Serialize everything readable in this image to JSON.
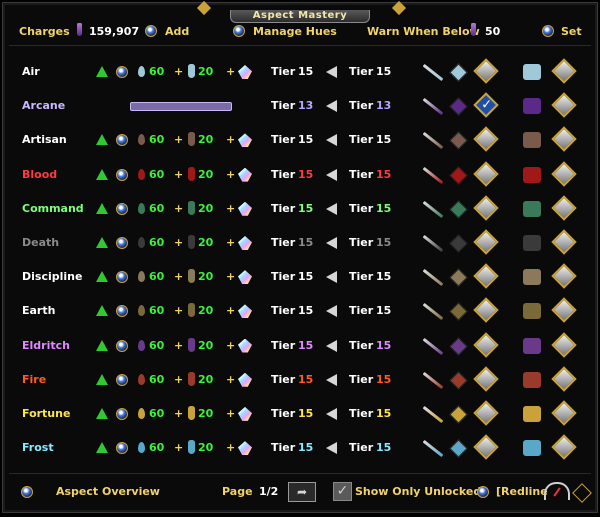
{
  "window": {
    "title": "Aspect Mastery"
  },
  "header": {
    "charges_label": "Charges",
    "charges_value": "159,907",
    "add_label": "Add",
    "manage_hues_label": "Manage Hues",
    "warn_label": "Warn When Below",
    "warn_value": "50",
    "set_label": "Set"
  },
  "aspects": [
    {
      "name": "Air",
      "color": "#ffffff",
      "unlocked": true,
      "stat1": "60",
      "stat2": "20",
      "tier_label": "Tier",
      "tier_a": "15",
      "tier_b": "15",
      "tier_color": "#ffffff",
      "accent": "#9fc8d8",
      "checked": false
    },
    {
      "name": "Arcane",
      "color": "#c9b8ff",
      "unlocked": false,
      "stat1": "",
      "stat2": "",
      "tier_label": "Tier",
      "tier_a": "13",
      "tier_b": "13",
      "tier_color": "#b2a8ff",
      "accent": "#5a2a8a",
      "checked": true
    },
    {
      "name": "Artisan",
      "color": "#ffffff",
      "unlocked": true,
      "stat1": "60",
      "stat2": "20",
      "tier_label": "Tier",
      "tier_a": "15",
      "tier_b": "15",
      "tier_color": "#ffffff",
      "accent": "#7a5a4a",
      "checked": false
    },
    {
      "name": "Blood",
      "color": "#ff3b3b",
      "unlocked": true,
      "stat1": "60",
      "stat2": "20",
      "tier_label": "Tier",
      "tier_a": "15",
      "tier_b": "15",
      "tier_color": "#ff3b3b",
      "accent": "#a01818",
      "checked": false
    },
    {
      "name": "Command",
      "color": "#7dff7d",
      "unlocked": true,
      "stat1": "60",
      "stat2": "20",
      "tier_label": "Tier",
      "tier_a": "15",
      "tier_b": "15",
      "tier_color": "#7dff7d",
      "accent": "#3a7a5a",
      "checked": false
    },
    {
      "name": "Death",
      "color": "#8a8a8a",
      "unlocked": true,
      "stat1": "60",
      "stat2": "20",
      "tier_label": "Tier",
      "tier_a": "15",
      "tier_b": "15",
      "tier_color": "#8a8a8a",
      "accent": "#3a3a3a",
      "checked": false
    },
    {
      "name": "Discipline",
      "color": "#ffffff",
      "unlocked": true,
      "stat1": "60",
      "stat2": "20",
      "tier_label": "Tier",
      "tier_a": "15",
      "tier_b": "15",
      "tier_color": "#ffffff",
      "accent": "#8a7a5a",
      "checked": false
    },
    {
      "name": "Earth",
      "color": "#ffffff",
      "unlocked": true,
      "stat1": "60",
      "stat2": "20",
      "tier_label": "Tier",
      "tier_a": "15",
      "tier_b": "15",
      "tier_color": "#ffffff",
      "accent": "#7a6a3a",
      "checked": false
    },
    {
      "name": "Eldritch",
      "color": "#e08aff",
      "unlocked": true,
      "stat1": "60",
      "stat2": "20",
      "tier_label": "Tier",
      "tier_a": "15",
      "tier_b": "15",
      "tier_color": "#e08aff",
      "accent": "#6a3a8a",
      "checked": false
    },
    {
      "name": "Fire",
      "color": "#ff5a2a",
      "unlocked": true,
      "stat1": "60",
      "stat2": "20",
      "tier_label": "Tier",
      "tier_a": "15",
      "tier_b": "15",
      "tier_color": "#ff5a2a",
      "accent": "#9a3a2a",
      "checked": false
    },
    {
      "name": "Fortune",
      "color": "#ffe34a",
      "unlocked": true,
      "stat1": "60",
      "stat2": "20",
      "tier_label": "Tier",
      "tier_a": "15",
      "tier_b": "15",
      "tier_color": "#ffe34a",
      "accent": "#c9a23a",
      "checked": false
    },
    {
      "name": "Frost",
      "color": "#8ae8ff",
      "unlocked": true,
      "stat1": "60",
      "stat2": "20",
      "tier_label": "Tier",
      "tier_a": "15",
      "tier_b": "15",
      "tier_color": "#8ae8ff",
      "accent": "#5aa8c8",
      "checked": false
    }
  ],
  "footer": {
    "overview_label": "Aspect Overview",
    "page_label": "Page",
    "page_value": "1/2",
    "show_unlocked_label": "Show Only Unlocked",
    "show_unlocked_checked": true,
    "redline_label": "[Redline"
  }
}
